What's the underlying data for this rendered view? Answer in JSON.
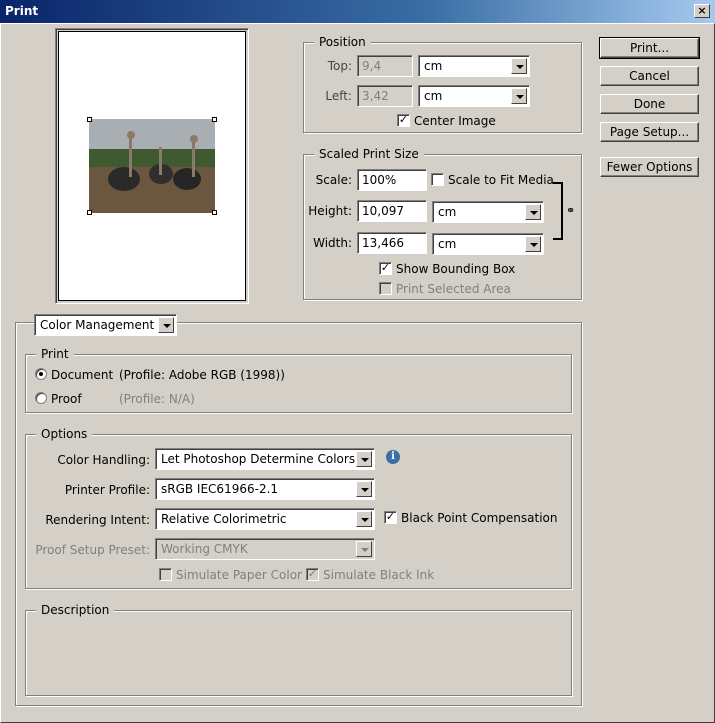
{
  "window": {
    "title": "Print",
    "close_glyph": "×"
  },
  "buttons": {
    "print": "Print...",
    "cancel": "Cancel",
    "done": "Done",
    "page_setup": "Page Setup...",
    "fewer_options": "Fewer Options"
  },
  "position": {
    "legend": "Position",
    "top_label": "Top:",
    "top_value": "9,4",
    "top_unit": "cm",
    "left_label": "Left:",
    "left_value": "3,42",
    "left_unit": "cm",
    "center_image_label": "Center Image",
    "center_image_checked": true
  },
  "scaled": {
    "legend": "Scaled Print Size",
    "scale_label": "Scale:",
    "scale_value": "100%",
    "scale_to_fit_label": "Scale to Fit Media",
    "scale_to_fit_checked": false,
    "height_label": "Height:",
    "height_value": "10,097",
    "height_unit": "cm",
    "width_label": "Width:",
    "width_value": "13,466",
    "width_unit": "cm",
    "show_bbox_label": "Show Bounding Box",
    "show_bbox_checked": true,
    "print_selected_label": "Print Selected Area",
    "print_selected_checked": false
  },
  "mode_select": "Color Management",
  "print_group": {
    "legend": "Print",
    "document_label": "Document",
    "document_profile": "(Profile: Adobe RGB (1998))",
    "proof_label": "Proof",
    "proof_profile": "(Profile: N/A)",
    "selected": "document"
  },
  "options": {
    "legend": "Options",
    "color_handling_label": "Color Handling:",
    "color_handling_value": "Let Photoshop Determine Colors",
    "printer_profile_label": "Printer Profile:",
    "printer_profile_value": "sRGB IEC61966-2.1",
    "rendering_intent_label": "Rendering Intent:",
    "rendering_intent_value": "Relative Colorimetric",
    "black_point_label": "Black Point Compensation",
    "black_point_checked": true,
    "proof_setup_label": "Proof Setup Preset:",
    "proof_setup_value": "Working CMYK",
    "simulate_paper_label": "Simulate Paper Color",
    "simulate_paper_checked": false,
    "simulate_black_label": "Simulate Black Ink",
    "simulate_black_checked": true
  },
  "description": {
    "legend": "Description"
  },
  "icons": {
    "info": "i",
    "check": "✓"
  },
  "colors": {
    "titlebar_start": "#0a246a",
    "titlebar_end": "#a6caf0",
    "face": "#d4d0c8"
  }
}
